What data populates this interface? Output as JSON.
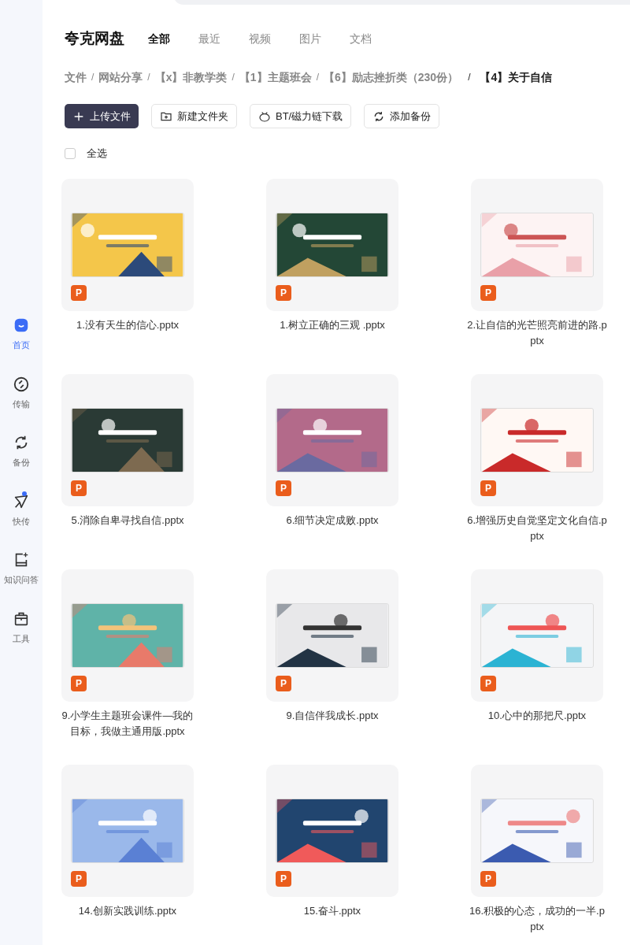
{
  "sidebar": {
    "items": [
      {
        "label": "首页",
        "selected": true,
        "dot": false
      },
      {
        "label": "传输",
        "selected": false,
        "dot": false
      },
      {
        "label": "备份",
        "selected": false,
        "dot": false
      },
      {
        "label": "快传",
        "selected": false,
        "dot": true
      },
      {
        "label": "知识问答",
        "selected": false,
        "dot": false
      },
      {
        "label": "工具",
        "selected": false,
        "dot": false
      }
    ]
  },
  "header": {
    "title": "夸克网盘",
    "tabs": [
      {
        "label": "全部",
        "selected": true
      },
      {
        "label": "最近",
        "selected": false
      },
      {
        "label": "视频",
        "selected": false
      },
      {
        "label": "图片",
        "selected": false
      },
      {
        "label": "文档",
        "selected": false
      }
    ]
  },
  "breadcrumb": [
    {
      "label": "文件"
    },
    {
      "separator": "/",
      "label": "网站分享"
    },
    {
      "separator": "/",
      "label": "【x】非教学类"
    },
    {
      "separator": "/",
      "label": "【1】主题班会"
    },
    {
      "separator": "/",
      "label": "【6】励志挫折类（230份）"
    },
    {
      "separator": "/",
      "label": "【4】关于自信"
    }
  ],
  "toolbar": [
    {
      "label": "上传文件",
      "kind": "primary"
    },
    {
      "label": "新建文件夹",
      "kind": "default"
    },
    {
      "label": "BT/磁力链下载",
      "kind": "default"
    },
    {
      "label": "添加备份",
      "kind": "default"
    }
  ],
  "select_all": {
    "label": "全选",
    "checked": false
  },
  "files": [
    {
      "name": "1.没有天生的信心.pptx",
      "badge": "P"
    },
    {
      "name": "1.树立正确的三观 .pptx",
      "badge": "P"
    },
    {
      "name": "2.让自信的光芒照亮前进的路.pptx",
      "badge": "P"
    },
    {
      "name": "5.消除自卑寻找自信.pptx",
      "badge": "P"
    },
    {
      "name": "6.细节决定成败.pptx",
      "badge": "P"
    },
    {
      "name": "6.增强历史自觉坚定文化自信.pptx",
      "badge": "P"
    },
    {
      "name": "9.小学生主题班会课件—我的目标，我做主通用版.pptx",
      "badge": "P"
    },
    {
      "name": "9.自信伴我成长.pptx",
      "badge": "P"
    },
    {
      "name": "10.心中的那把尺.pptx",
      "badge": "P"
    },
    {
      "name": "14.创新实践训练.pptx",
      "badge": "P"
    },
    {
      "name": "15.奋斗.pptx",
      "badge": "P"
    },
    {
      "name": "16.积极的心态，成功的一半.pptx",
      "badge": "P"
    }
  ]
}
